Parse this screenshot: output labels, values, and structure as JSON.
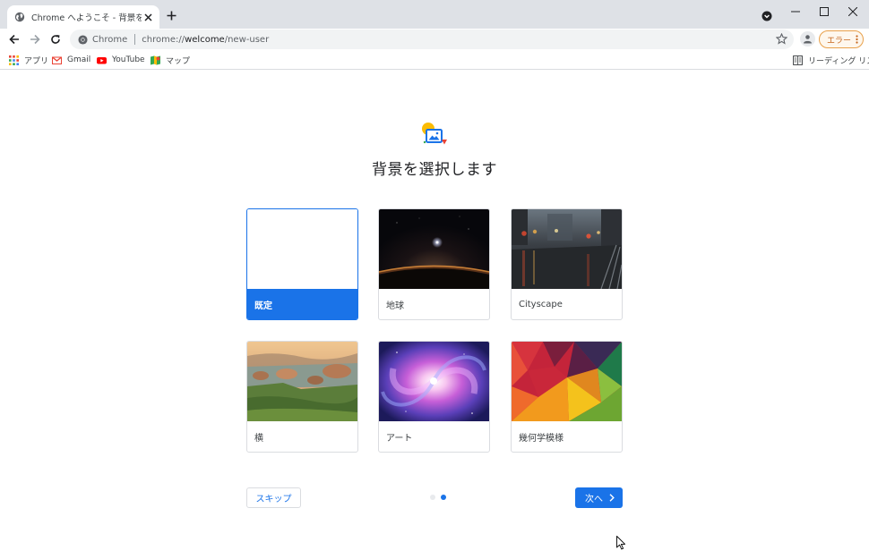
{
  "tab": {
    "title": "Chrome へようこそ - 背景を選択します"
  },
  "toolbar": {
    "origin_label": "Chrome",
    "url_host": "chrome://",
    "url_path_bold": "welcome",
    "url_path_rest": "/new-user",
    "error_label": "エラー"
  },
  "bookmarks": [
    {
      "label": "アプリ"
    },
    {
      "label": "Gmail"
    },
    {
      "label": "YouTube"
    },
    {
      "label": "マップ"
    }
  ],
  "reading_list": {
    "label": "リーディング リスト"
  },
  "page": {
    "title": "背景を選択します",
    "cards": [
      {
        "label": "既定"
      },
      {
        "label": "地球"
      },
      {
        "label": "Cityscape"
      },
      {
        "label": "横"
      },
      {
        "label": "アート"
      },
      {
        "label": "幾何学模様"
      }
    ],
    "skip_label": "スキップ",
    "next_label": "次へ"
  },
  "colors": {
    "accent": "#1a73e8",
    "tab_strip": "#dee1e6",
    "omnibox": "#f1f3f4",
    "error": "#c5641a"
  }
}
